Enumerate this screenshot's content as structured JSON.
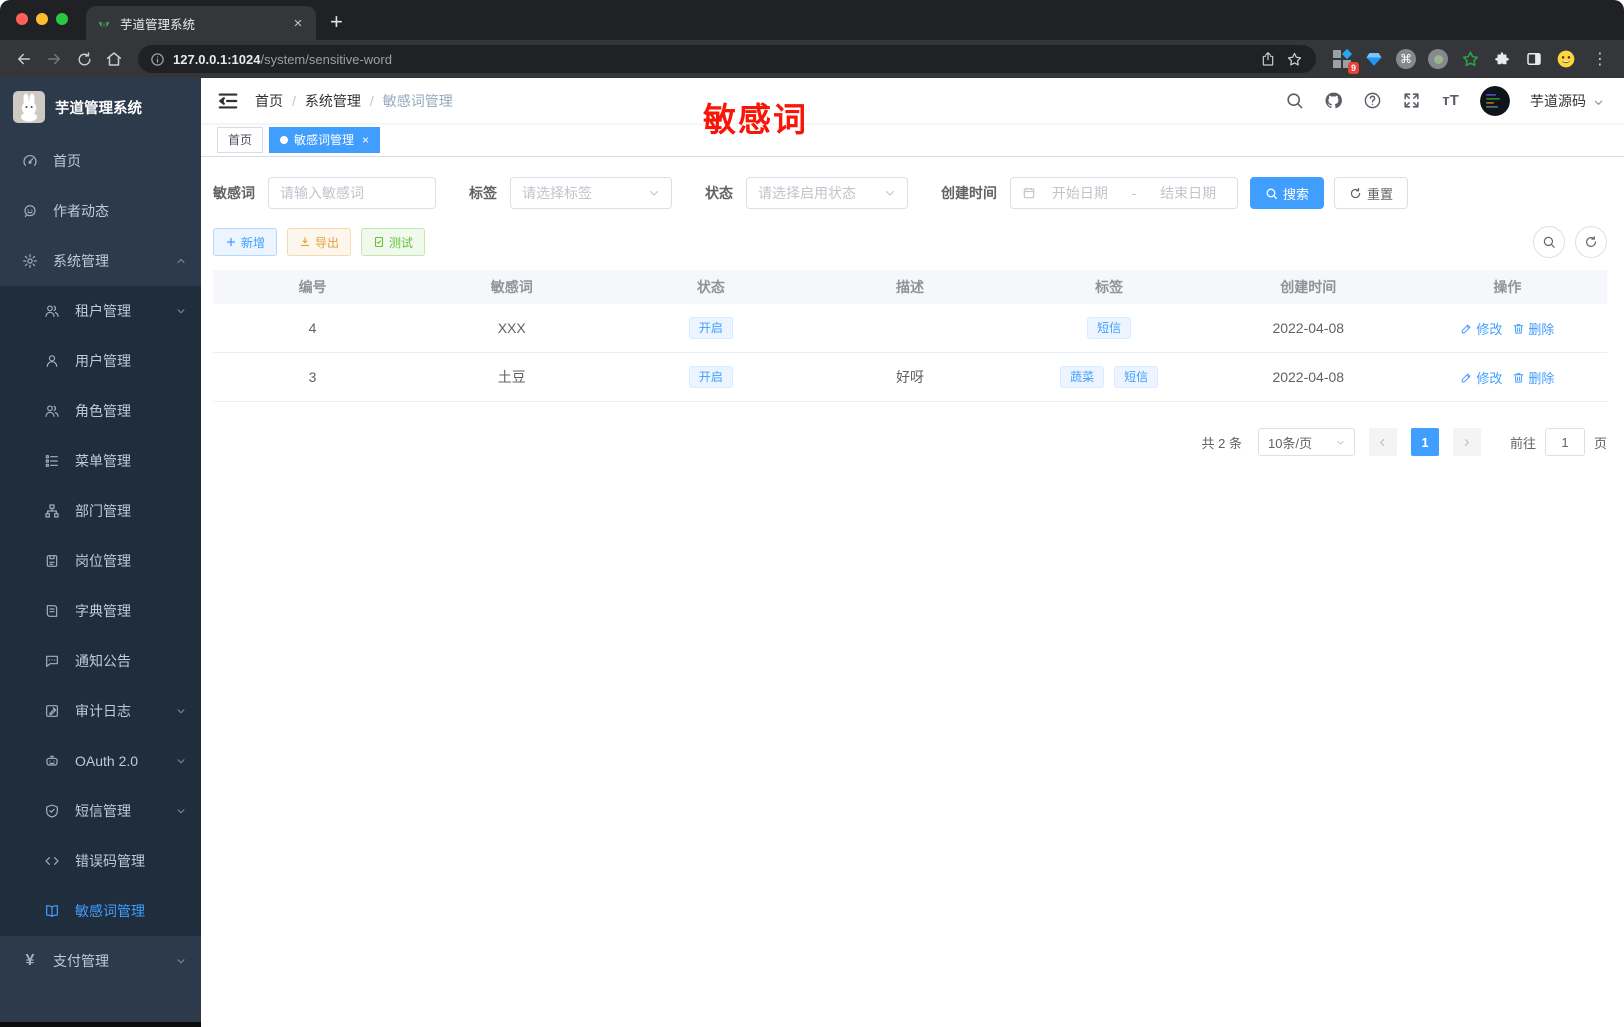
{
  "browser": {
    "tab_title": "芋道管理系统",
    "url_host": "127.0.0.1:1024",
    "url_path": "/system/sensitive-word",
    "extension_badge": "9"
  },
  "sidebar": {
    "logo_title": "芋道管理系统",
    "items": [
      {
        "label": "首页",
        "icon": "dashboard",
        "level": "root"
      },
      {
        "label": "作者动态",
        "icon": "chatface",
        "level": "root"
      },
      {
        "label": "系统管理",
        "icon": "gear",
        "level": "root",
        "caret": "up"
      },
      {
        "label": "租户管理",
        "icon": "users",
        "level": "sub",
        "caret": "down"
      },
      {
        "label": "用户管理",
        "icon": "user",
        "level": "sub"
      },
      {
        "label": "角色管理",
        "icon": "users",
        "level": "sub"
      },
      {
        "label": "菜单管理",
        "icon": "tree",
        "level": "sub"
      },
      {
        "label": "部门管理",
        "icon": "org",
        "level": "sub"
      },
      {
        "label": "岗位管理",
        "icon": "badge",
        "level": "sub"
      },
      {
        "label": "字典管理",
        "icon": "book",
        "level": "sub"
      },
      {
        "label": "通知公告",
        "icon": "chatdots",
        "level": "sub"
      },
      {
        "label": "审计日志",
        "icon": "log",
        "level": "sub",
        "caret": "down"
      },
      {
        "label": "OAuth 2.0",
        "icon": "robot",
        "level": "sub",
        "caret": "down"
      },
      {
        "label": "短信管理",
        "icon": "shield",
        "level": "sub",
        "caret": "down"
      },
      {
        "label": "错误码管理",
        "icon": "code",
        "level": "sub"
      },
      {
        "label": "敏感词管理",
        "icon": "bookopen",
        "level": "sub",
        "active": true
      },
      {
        "label": "支付管理",
        "icon": "yen",
        "level": "root",
        "caret": "down"
      }
    ]
  },
  "header": {
    "breadcrumb": [
      "首页",
      "系统管理",
      "敏感词管理"
    ],
    "annotation": "敏感词",
    "username": "芋道源码"
  },
  "view_tabs": [
    {
      "label": "首页",
      "active": false,
      "closable": false
    },
    {
      "label": "敏感词管理",
      "active": true,
      "closable": true
    }
  ],
  "filters": {
    "keyword_label": "敏感词",
    "keyword_placeholder": "请输入敏感词",
    "tag_label": "标签",
    "tag_placeholder": "请选择标签",
    "status_label": "状态",
    "status_placeholder": "请选择启用状态",
    "date_label": "创建时间",
    "date_start_placeholder": "开始日期",
    "date_separator": "-",
    "date_end_placeholder": "结束日期",
    "search_label": "搜索",
    "reset_label": "重置"
  },
  "toolbar": {
    "add_label": "新增",
    "export_label": "导出",
    "test_label": "测试"
  },
  "table": {
    "columns": [
      "编号",
      "敏感词",
      "状态",
      "描述",
      "标签",
      "创建时间",
      "操作"
    ],
    "rows": [
      {
        "id": "4",
        "word": "XXX",
        "status": "开启",
        "description": "",
        "tags": [
          "短信"
        ],
        "created": "2022-04-08"
      },
      {
        "id": "3",
        "word": "土豆",
        "status": "开启",
        "description": "好呀",
        "tags": [
          "蔬菜",
          "短信"
        ],
        "created": "2022-04-08"
      }
    ],
    "edit_label": "修改",
    "delete_label": "删除"
  },
  "pagination": {
    "total": "共 2 条",
    "page_size": "10条/页",
    "current_page": "1",
    "goto_label": "前往",
    "goto_value": "1",
    "page_unit": "页"
  },
  "colors": {
    "primary": "#409eff",
    "sidebar_bg": "#2d3a4b",
    "submenu_bg": "#1f2d3d",
    "annotation_red": "#f91608",
    "warning": "#e6a23c",
    "success": "#67c23a"
  }
}
